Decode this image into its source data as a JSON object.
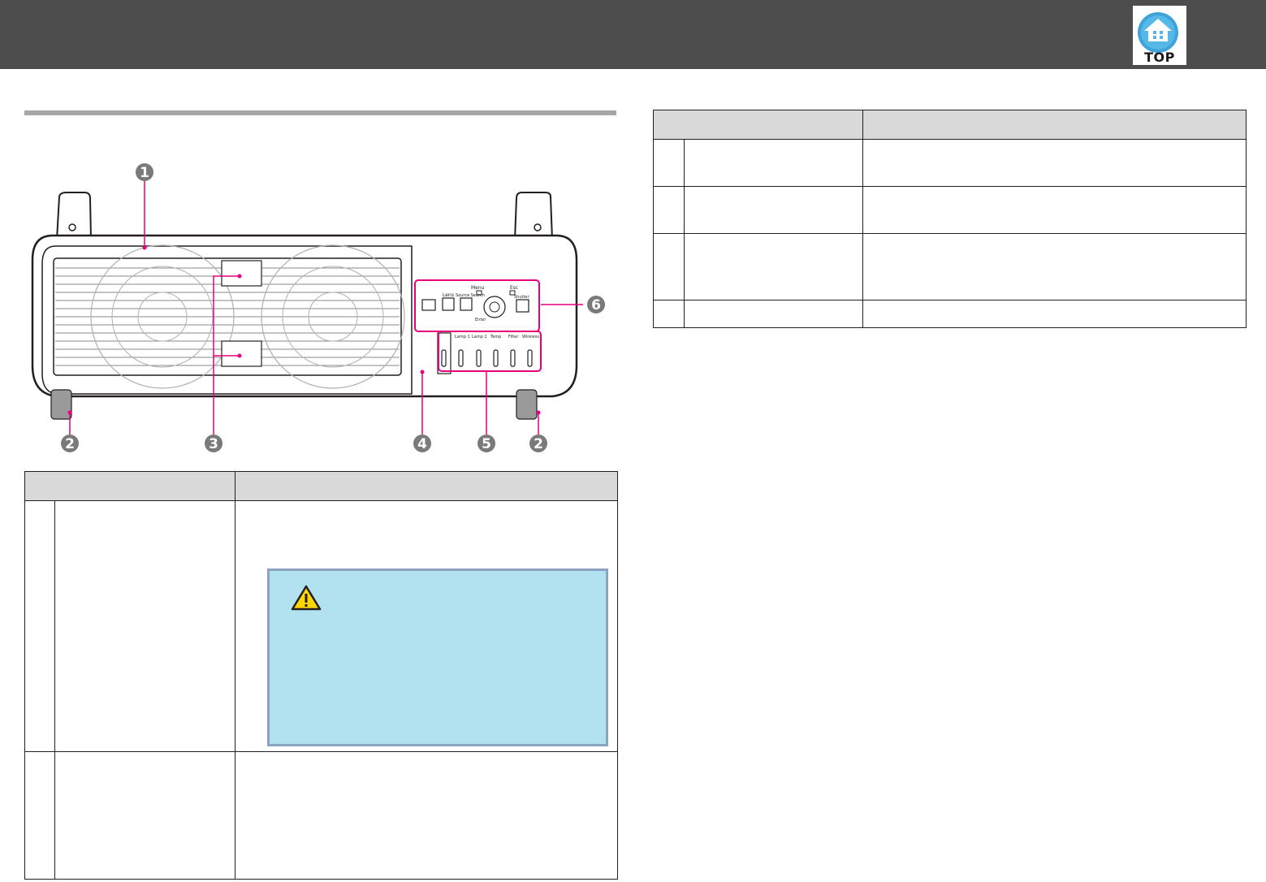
{
  "header": {
    "top_button_label": "TOP",
    "top_icon": "home-icon"
  },
  "figure": {
    "callouts": [
      "1",
      "2",
      "3",
      "4",
      "5",
      "6",
      "2"
    ],
    "control_panel_labels": {
      "menu": "Menu",
      "esc": "Esc",
      "lens": "Lens",
      "source_search": "Source Search",
      "shutter": "Shutter",
      "enter": "Enter"
    },
    "indicator_labels": [
      "Lamp 1",
      "Lamp 2",
      "Temp",
      "Filter",
      "Wireless"
    ]
  },
  "caution_icon": "warning-icon",
  "colors": {
    "header_bg": "#4d4d4d",
    "callout_magenta": "#e6007e",
    "table_header_bg": "#d9d9d9",
    "caution_bg": "#b2e2ef",
    "caution_border": "#8aa4c4"
  }
}
